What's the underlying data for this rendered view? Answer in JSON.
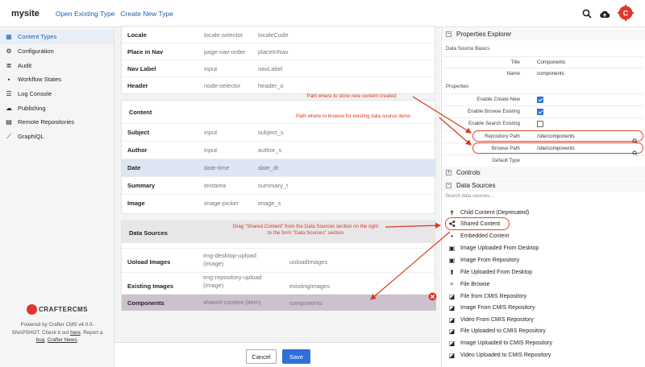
{
  "header": {
    "site": "mysite",
    "links": [
      "Open Existing Type",
      "Create New Type"
    ]
  },
  "sidebar": {
    "items": [
      {
        "label": "Content Types",
        "icon": "grid-icon"
      },
      {
        "label": "Configuration",
        "icon": "gear-icon"
      },
      {
        "label": "Audit",
        "icon": "list-icon"
      },
      {
        "label": "Workflow States",
        "icon": "workflow-icon"
      },
      {
        "label": "Log Console",
        "icon": "console-icon"
      },
      {
        "label": "Publishing",
        "icon": "cloud-icon"
      },
      {
        "label": "Remote Repositories",
        "icon": "database-icon"
      },
      {
        "label": "GraphiQL",
        "icon": "chart-icon"
      }
    ],
    "footer": {
      "brand": "CRAFTERCMS",
      "line1": "Powered by Crafter CMS v4.0.0-",
      "line2": "SNAPSHOT. Check it out",
      "here": "here",
      "report": ". Report a",
      "bug": "bug",
      "news": "Crafter News",
      "end": "."
    }
  },
  "form": {
    "top_rows": [
      {
        "label": "Locale",
        "type": "locale-selector",
        "id": "localeCode"
      },
      {
        "label": "Place in Nav",
        "type": "page-nav-order",
        "id": "placeInNav"
      },
      {
        "label": "Nav Label",
        "type": "input",
        "id": "navLabel"
      },
      {
        "label": "Header",
        "type": "node-selector",
        "id": "header_o"
      }
    ],
    "content_title": "Content",
    "content_rows": [
      {
        "label": "Subject",
        "type": "input",
        "id": "subject_s"
      },
      {
        "label": "Author",
        "type": "input",
        "id": "author_s"
      },
      {
        "label": "Date",
        "type": "date-time",
        "id": "date_dt"
      },
      {
        "label": "Summary",
        "type": "textarea",
        "id": "summary_t"
      },
      {
        "label": "Image",
        "type": "image-picker",
        "id": "image_s"
      }
    ],
    "ds_title": "Data Sources",
    "ds_rows": [
      {
        "label": "Uoload Images",
        "type1": "img-desktop-upload",
        "type2": "(image)",
        "id": "uoloadImages"
      },
      {
        "label": "Existing Images",
        "type1": "img-repository-upload",
        "type2": "(image)",
        "id": "existingImages"
      },
      {
        "label": "Components",
        "type1": "shared-content (item)",
        "type2": "",
        "id": "components"
      }
    ],
    "cancel_label": "Cancel",
    "save_label": "Save"
  },
  "properties": {
    "title": "Properties Explorer",
    "basics_title": "Data Source Basics",
    "basics": [
      {
        "label": "Title",
        "value": "Components"
      },
      {
        "label": "Name",
        "value": "components"
      }
    ],
    "props_title": "Properties",
    "checks": [
      {
        "label": "Enable Create New",
        "checked": true
      },
      {
        "label": "Enable Browse Existing",
        "checked": true
      },
      {
        "label": "Enable Search Existing",
        "checked": false
      }
    ],
    "paths": [
      {
        "label": "Repository Path",
        "value": "/site/components"
      },
      {
        "label": "Browse Path",
        "value": "/site/components"
      }
    ],
    "default_type_label": "Default Type",
    "controls_title": "Controls",
    "datasources_title": "Data Sources",
    "search_placeholder": "Search data sources...",
    "datasources": [
      {
        "label": "Child Content (Deprecated)",
        "icon": "child-icon"
      },
      {
        "label": "Shared Content",
        "icon": "share-icon"
      },
      {
        "label": "Embedded Content",
        "icon": "embedded-icon"
      },
      {
        "label": "Image Uploaded From Desktop",
        "icon": "image-icon"
      },
      {
        "label": "Image From Repository",
        "icon": "image-icon"
      },
      {
        "label": "File Uploaded From Desktop",
        "icon": "upload-icon"
      },
      {
        "label": "File Browse",
        "icon": "search-icon"
      },
      {
        "label": "File from CMIS Repository",
        "icon": "cmis-icon"
      },
      {
        "label": "Image From CMIS Repository",
        "icon": "cmis-icon"
      },
      {
        "label": "Video From CMIS Repository",
        "icon": "cmis-icon"
      },
      {
        "label": "File Uploaded to CMIS Repository",
        "icon": "cmis-icon"
      },
      {
        "label": "Image Uploaded to CMIS Repository",
        "icon": "cmis-icon"
      },
      {
        "label": "Video Uploaded to CMIS Repository",
        "icon": "cmis-icon"
      }
    ]
  },
  "annotations": {
    "a1": "Path where to store new content created",
    "a2": "Path where to browse for existing data source items",
    "a3_line1": "Drag “Shared Content” from the Data Sources section on the right",
    "a3_line2": "to the form “Data Sources” section"
  },
  "colors": {
    "accent": "#2f6fd8",
    "annotation": "#d63a1c",
    "brand": "#e0362c"
  }
}
